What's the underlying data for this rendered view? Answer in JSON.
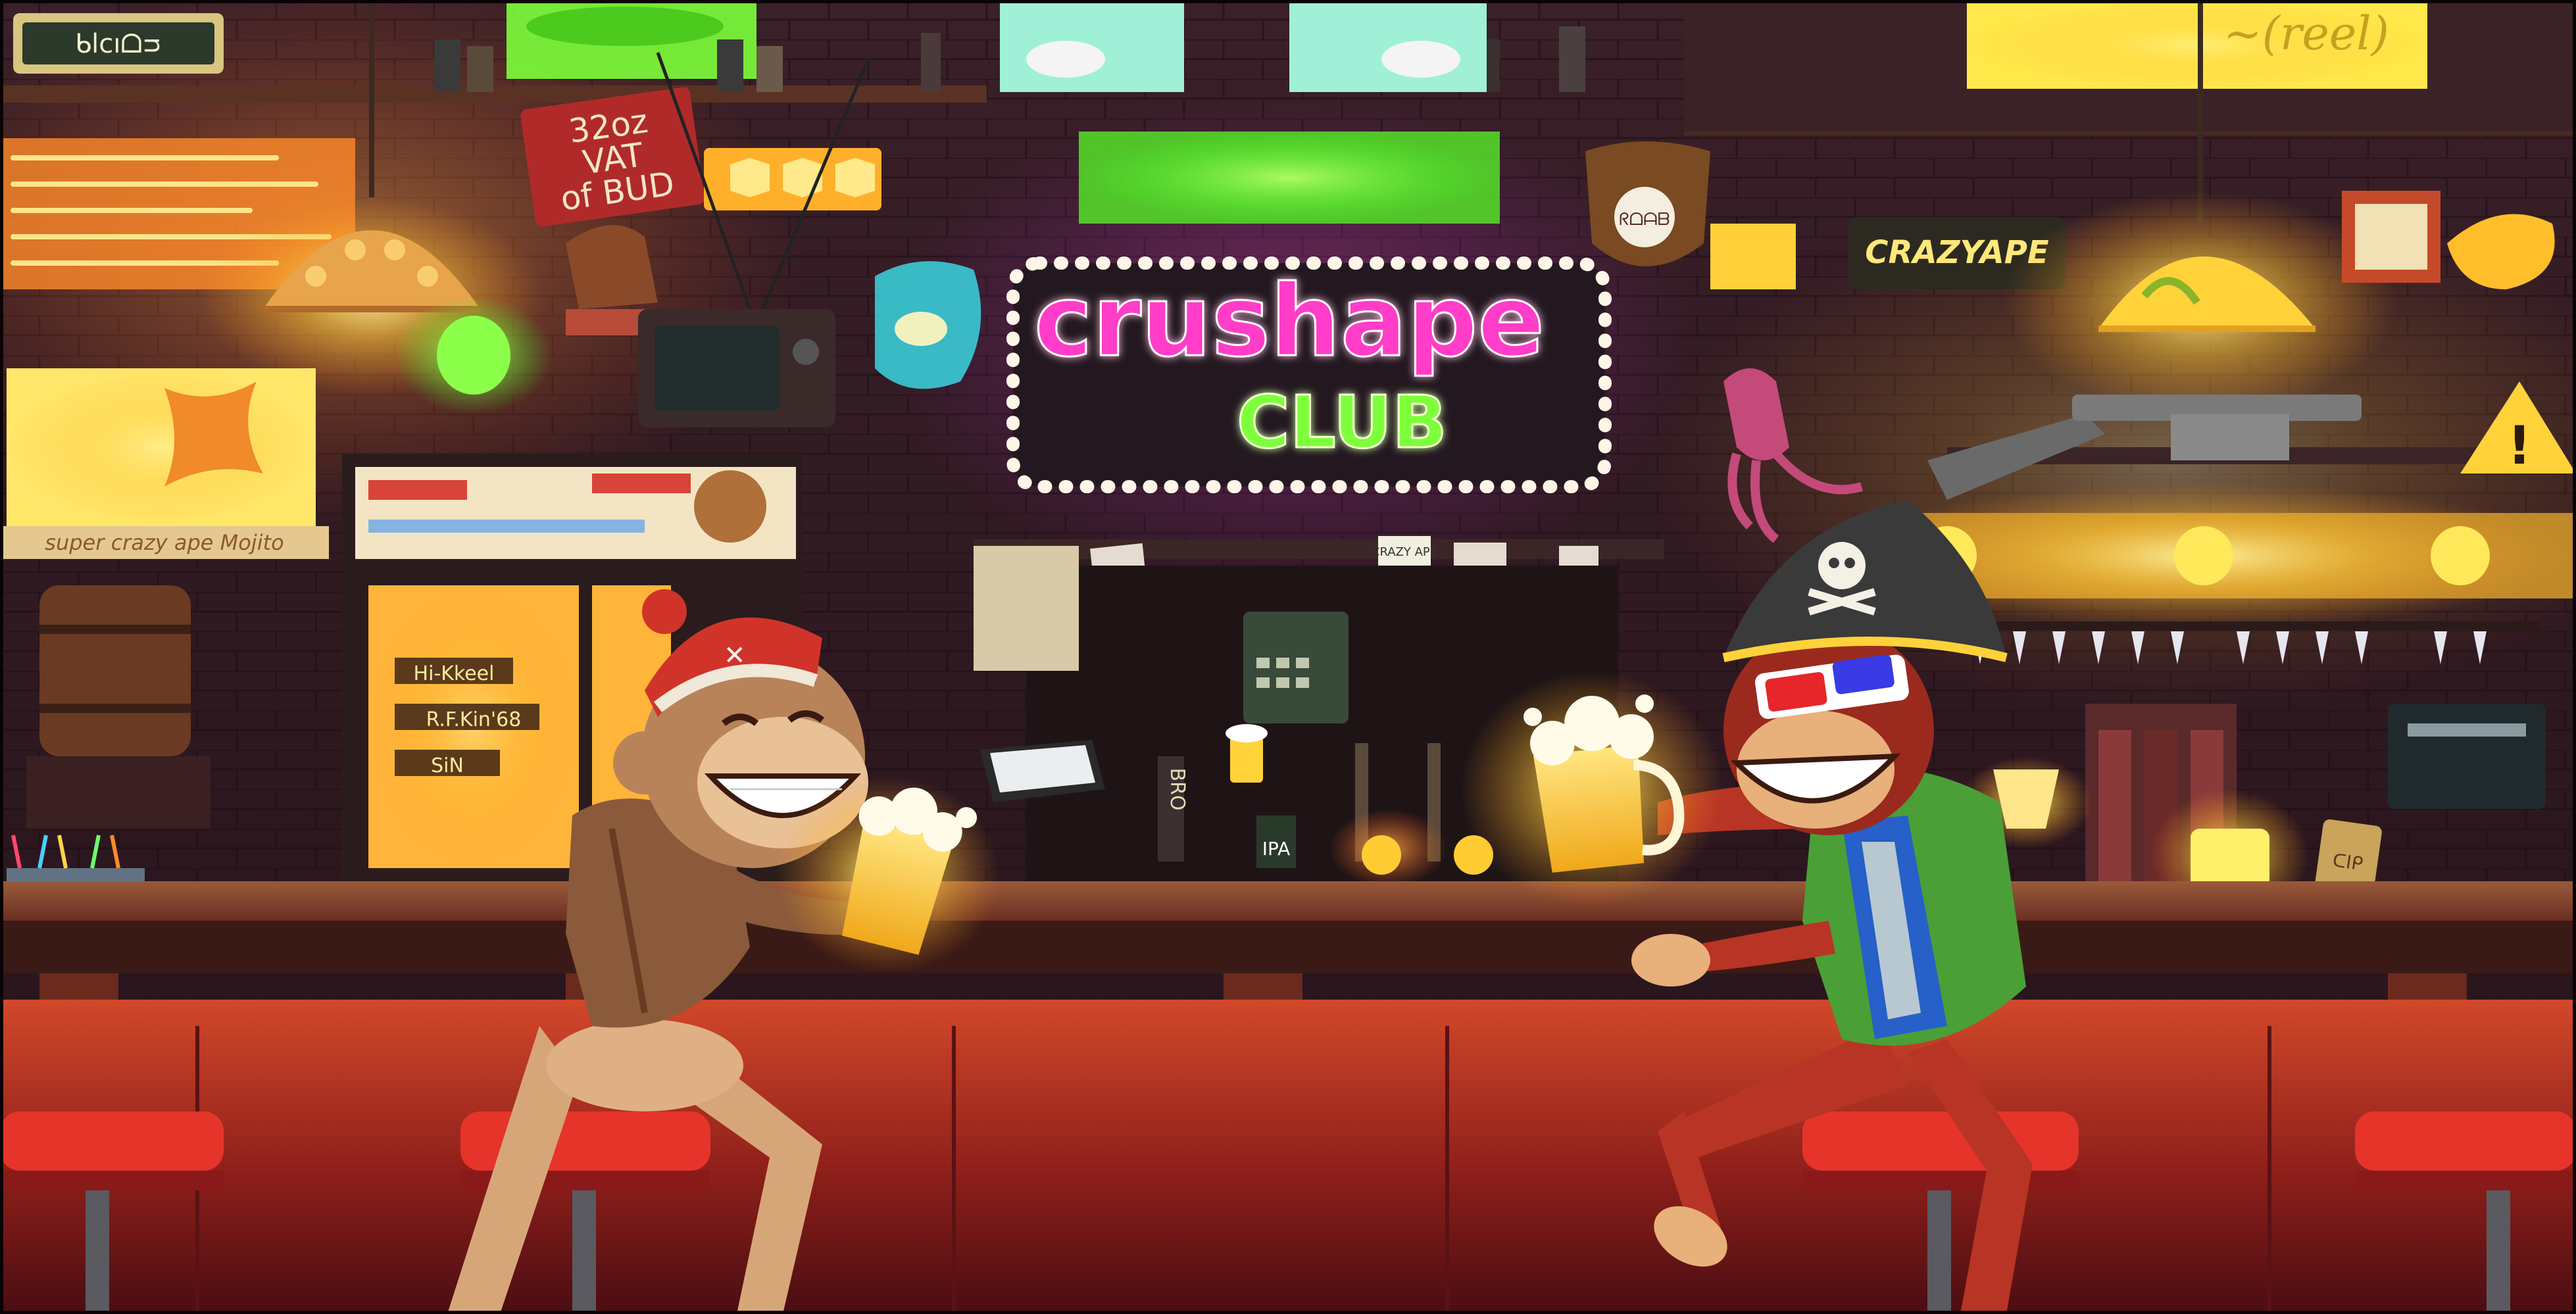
{
  "signs": {
    "club_line1": "crushape",
    "club_line2": "CLUB",
    "vat_line1": "32oz",
    "vat_line2": "VAT",
    "vat_line3": "of BUD",
    "mojito": "super crazy ape Mojito",
    "crazyape": "CRAZYAPE",
    "bro": "BRO",
    "ipa": "IPA",
    "top_left": "ᑲlcıᗝᴝ",
    "pirate_tag": "ᖇᗝᗩᗷ",
    "poster_sticker": "R.F.Kin'68",
    "poster_sticker2": "Hi-Kkeel",
    "poster_sticker3": "SiN",
    "small_sign": "CRAZY APE",
    "sign_right": "~(reel)",
    "tip_jar": "ᑕIᑭ"
  },
  "colors": {
    "wall": "#2a1620",
    "neon_magenta": "#ff3ec8",
    "neon_lime": "#7dff3a",
    "counter": "#b5341e",
    "beer": "#ffd23a",
    "glow_yellow": "#ffe35a"
  }
}
